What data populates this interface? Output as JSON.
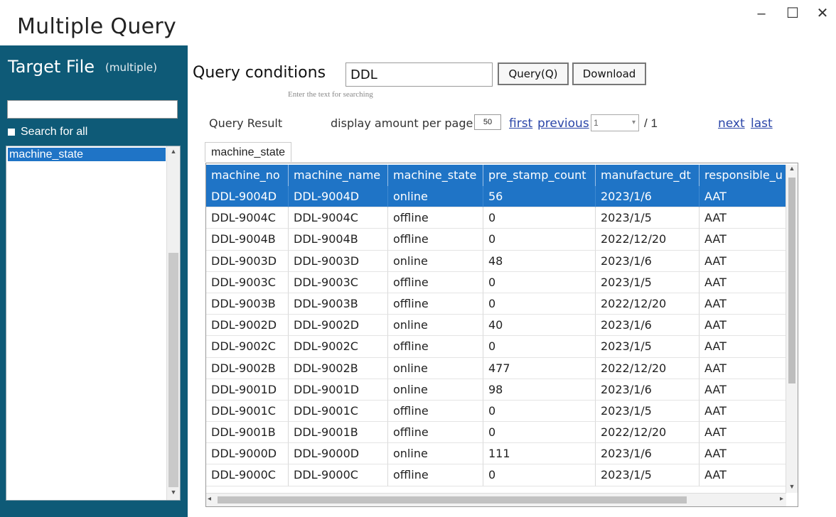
{
  "window": {
    "title": "Multiple Query",
    "min_glyph": "–",
    "max_glyph": "☐",
    "close_glyph": "✕"
  },
  "sidebar": {
    "title": "Target File",
    "subtitle": "(multiple)",
    "search_value": "",
    "search_all_label": "Search for all",
    "items": [
      {
        "label": "machine_state",
        "selected": true
      }
    ]
  },
  "query": {
    "label": "Query conditions",
    "value": "DDL",
    "hint": "Enter the text for searching",
    "query_button": "Query(Q)",
    "download_button": "Download"
  },
  "pager": {
    "result_label": "Query Result",
    "amount_label": "display amount per page",
    "per_page": "50",
    "first": "first",
    "previous": "previous",
    "current_page": "1",
    "total": "/ 1",
    "next": "next",
    "last": "last"
  },
  "tab": {
    "label": "machine_state"
  },
  "table": {
    "columns": [
      "machine_no",
      "machine_name",
      "machine_state",
      "pre_stamp_count",
      "manufacture_dt",
      "responsible_u"
    ],
    "rows": [
      [
        "DDL-9004D",
        "DDL-9004D",
        "online",
        "56",
        "2023/1/6",
        "AAT"
      ],
      [
        "DDL-9004C",
        "DDL-9004C",
        "offline",
        "0",
        "2023/1/5",
        "AAT"
      ],
      [
        "DDL-9004B",
        "DDL-9004B",
        "offline",
        "0",
        "2022/12/20",
        "AAT"
      ],
      [
        "DDL-9003D",
        "DDL-9003D",
        "online",
        "48",
        "2023/1/6",
        "AAT"
      ],
      [
        "DDL-9003C",
        "DDL-9003C",
        "offline",
        "0",
        "2023/1/5",
        "AAT"
      ],
      [
        "DDL-9003B",
        "DDL-9003B",
        "offline",
        "0",
        "2022/12/20",
        "AAT"
      ],
      [
        "DDL-9002D",
        "DDL-9002D",
        "online",
        "40",
        "2023/1/6",
        "AAT"
      ],
      [
        "DDL-9002C",
        "DDL-9002C",
        "offline",
        "0",
        "2023/1/5",
        "AAT"
      ],
      [
        "DDL-9002B",
        "DDL-9002B",
        "online",
        "477",
        "2022/12/20",
        "AAT"
      ],
      [
        "DDL-9001D",
        "DDL-9001D",
        "online",
        "98",
        "2023/1/6",
        "AAT"
      ],
      [
        "DDL-9001C",
        "DDL-9001C",
        "offline",
        "0",
        "2023/1/5",
        "AAT"
      ],
      [
        "DDL-9001B",
        "DDL-9001B",
        "offline",
        "0",
        "2022/12/20",
        "AAT"
      ],
      [
        "DDL-9000D",
        "DDL-9000D",
        "online",
        "111",
        "2023/1/6",
        "AAT"
      ],
      [
        "DDL-9000C",
        "DDL-9000C",
        "offline",
        "0",
        "2023/1/5",
        "AAT"
      ]
    ],
    "selected_row": 0
  },
  "colors": {
    "sidebar_bg": "#0e5a77",
    "selection": "#1f74c6",
    "link": "#2a45a8"
  }
}
